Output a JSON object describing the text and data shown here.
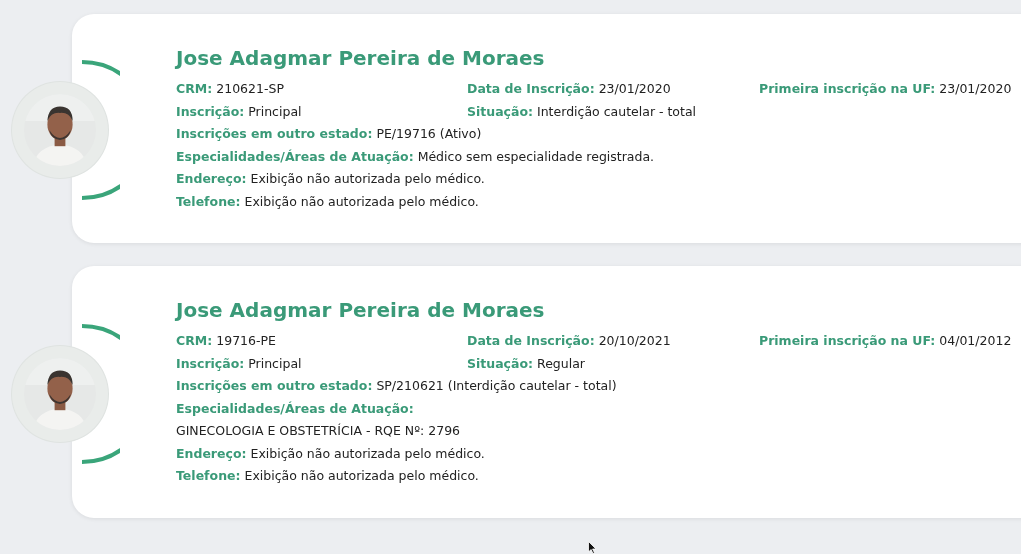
{
  "doctors": [
    {
      "name": "Jose Adagmar Pereira de Moraes",
      "photo": {
        "kind": "picture"
      },
      "grid": [
        [
          {
            "label": "CRM:",
            "value": "210621-SP"
          },
          {
            "label": "Data de Inscrição:",
            "value": "23/01/2020"
          },
          {
            "label": "Primeira inscrição na UF:",
            "value": "23/01/2020"
          }
        ],
        [
          {
            "label": "Inscrição:",
            "value": "Principal"
          },
          {
            "label": "Situação:",
            "value": "Interdição cautelar - total"
          }
        ]
      ],
      "lines": [
        {
          "label": "Inscrições em outro estado:",
          "value": "PE/19716 (Ativo)"
        },
        {
          "label": "Especialidades/Áreas de Atuação:",
          "value": "Médico sem especialidade registrada."
        },
        {
          "label": "Endereço:",
          "value": "Exibição não autorizada pelo médico."
        },
        {
          "label": "Telefone:",
          "value": "Exibição não autorizada pelo médico."
        }
      ]
    },
    {
      "name": "Jose Adagmar Pereira de Moraes",
      "photo": {
        "kind": "picture"
      },
      "grid": [
        [
          {
            "label": "CRM:",
            "value": "19716-PE"
          },
          {
            "label": "Data de Inscrição:",
            "value": "20/10/2021"
          },
          {
            "label": "Primeira inscrição na UF:",
            "value": "04/01/2012"
          }
        ],
        [
          {
            "label": "Inscrição:",
            "value": "Principal"
          },
          {
            "label": "Situação:",
            "value": "Regular"
          }
        ]
      ],
      "lines": [
        {
          "label": "Inscrições em outro estado:",
          "value": "SP/210621 (Interdição cautelar - total)"
        },
        {
          "label": "Especialidades/Áreas de Atuação:"
        },
        {
          "value": "GINECOLOGIA E OBSTETRÍCIA - RQE Nº: 2796"
        },
        {
          "label": "Endereço:",
          "value": "Exibição não autorizada pelo médico."
        },
        {
          "label": "Telefone:",
          "value": "Exibição não autorizada pelo médico."
        }
      ]
    }
  ]
}
